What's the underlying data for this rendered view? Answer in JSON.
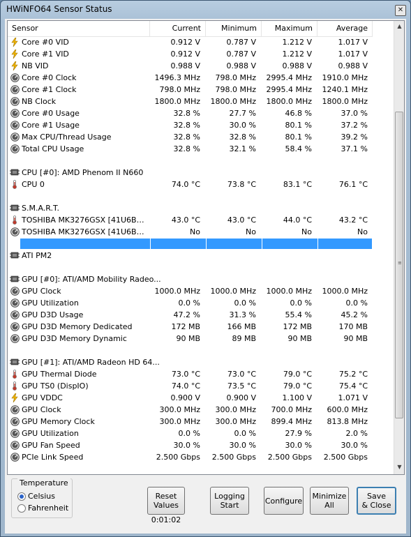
{
  "window": {
    "title": "HWiNFO64 Sensor Status",
    "close_glyph": "✕"
  },
  "columns": {
    "sensor": "Sensor",
    "current": "Current",
    "minimum": "Minimum",
    "maximum": "Maximum",
    "average": "Average"
  },
  "rows": [
    {
      "type": "data",
      "icon": "bolt",
      "name": "Core #0 VID",
      "cur": "0.912 V",
      "min": "0.787 V",
      "max": "1.212 V",
      "avg": "1.017 V"
    },
    {
      "type": "data",
      "icon": "bolt",
      "name": "Core #1 VID",
      "cur": "0.912 V",
      "min": "0.787 V",
      "max": "1.212 V",
      "avg": "1.017 V"
    },
    {
      "type": "data",
      "icon": "bolt",
      "name": "NB VID",
      "cur": "0.988 V",
      "min": "0.988 V",
      "max": "0.988 V",
      "avg": "0.988 V"
    },
    {
      "type": "data",
      "icon": "gauge",
      "name": "Core #0 Clock",
      "cur": "1496.3 MHz",
      "min": "798.0 MHz",
      "max": "2995.4 MHz",
      "avg": "1910.0 MHz"
    },
    {
      "type": "data",
      "icon": "gauge",
      "name": "Core #1 Clock",
      "cur": "798.0 MHz",
      "min": "798.0 MHz",
      "max": "2995.4 MHz",
      "avg": "1240.1 MHz"
    },
    {
      "type": "data",
      "icon": "gauge",
      "name": "NB Clock",
      "cur": "1800.0 MHz",
      "min": "1800.0 MHz",
      "max": "1800.0 MHz",
      "avg": "1800.0 MHz"
    },
    {
      "type": "data",
      "icon": "gauge",
      "name": "Core #0 Usage",
      "cur": "32.8 %",
      "min": "27.7 %",
      "max": "46.8 %",
      "avg": "37.0 %"
    },
    {
      "type": "data",
      "icon": "gauge",
      "name": "Core #1 Usage",
      "cur": "32.8 %",
      "min": "30.0 %",
      "max": "80.1 %",
      "avg": "37.2 %"
    },
    {
      "type": "data",
      "icon": "gauge",
      "name": "Max CPU/Thread Usage",
      "cur": "32.8 %",
      "min": "32.8 %",
      "max": "80.1 %",
      "avg": "39.2 %"
    },
    {
      "type": "data",
      "icon": "gauge",
      "name": "Total CPU Usage",
      "cur": "32.8 %",
      "min": "32.1 %",
      "max": "58.4 %",
      "avg": "37.1 %"
    },
    {
      "type": "blank"
    },
    {
      "type": "group",
      "icon": "chip",
      "name": "CPU [#0]: AMD Phenom II N660"
    },
    {
      "type": "data",
      "icon": "thermo",
      "name": "CPU 0",
      "cur": "74.0 °C",
      "min": "73.8 °C",
      "max": "83.1 °C",
      "avg": "76.1 °C"
    },
    {
      "type": "blank"
    },
    {
      "type": "group",
      "icon": "chip",
      "name": "S.M.A.R.T."
    },
    {
      "type": "data",
      "icon": "thermo",
      "name": "TOSHIBA MK3276GSX [41U6B01SB...",
      "cur": "43.0 °C",
      "min": "43.0 °C",
      "max": "44.0 °C",
      "avg": "43.2 °C"
    },
    {
      "type": "data",
      "icon": "gauge",
      "name": "TOSHIBA MK3276GSX [41U6B01SB...",
      "cur": "No",
      "min": "No",
      "max": "No",
      "avg": "No"
    },
    {
      "type": "selected"
    },
    {
      "type": "group",
      "icon": "chip",
      "name": "ATI PM2"
    },
    {
      "type": "blank"
    },
    {
      "type": "group",
      "icon": "chip",
      "name": "GPU [#0]: ATI/AMD Mobility Radeo..."
    },
    {
      "type": "data",
      "icon": "gauge",
      "name": "GPU Clock",
      "cur": "1000.0 MHz",
      "min": "1000.0 MHz",
      "max": "1000.0 MHz",
      "avg": "1000.0 MHz"
    },
    {
      "type": "data",
      "icon": "gauge",
      "name": "GPU Utilization",
      "cur": "0.0 %",
      "min": "0.0 %",
      "max": "0.0 %",
      "avg": "0.0 %"
    },
    {
      "type": "data",
      "icon": "gauge",
      "name": "GPU D3D Usage",
      "cur": "47.2 %",
      "min": "31.3 %",
      "max": "55.4 %",
      "avg": "45.2 %"
    },
    {
      "type": "data",
      "icon": "gauge",
      "name": "GPU D3D Memory Dedicated",
      "cur": "172 MB",
      "min": "166 MB",
      "max": "172 MB",
      "avg": "170 MB"
    },
    {
      "type": "data",
      "icon": "gauge",
      "name": "GPU D3D Memory Dynamic",
      "cur": "90 MB",
      "min": "89 MB",
      "max": "90 MB",
      "avg": "90 MB"
    },
    {
      "type": "blank"
    },
    {
      "type": "group",
      "icon": "chip",
      "name": "GPU [#1]: ATI/AMD Radeon HD 64..."
    },
    {
      "type": "data",
      "icon": "thermo",
      "name": "GPU Thermal Diode",
      "cur": "73.0 °C",
      "min": "73.0 °C",
      "max": "79.0 °C",
      "avg": "75.2 °C"
    },
    {
      "type": "data",
      "icon": "thermo",
      "name": "GPU TS0 (DispIO)",
      "cur": "74.0 °C",
      "min": "73.5 °C",
      "max": "79.0 °C",
      "avg": "75.4 °C"
    },
    {
      "type": "data",
      "icon": "bolt",
      "name": "GPU VDDC",
      "cur": "0.900 V",
      "min": "0.900 V",
      "max": "1.100 V",
      "avg": "1.071 V"
    },
    {
      "type": "data",
      "icon": "gauge",
      "name": "GPU Clock",
      "cur": "300.0 MHz",
      "min": "300.0 MHz",
      "max": "700.0 MHz",
      "avg": "600.0 MHz"
    },
    {
      "type": "data",
      "icon": "gauge",
      "name": "GPU Memory Clock",
      "cur": "300.0 MHz",
      "min": "300.0 MHz",
      "max": "899.4 MHz",
      "avg": "813.8 MHz"
    },
    {
      "type": "data",
      "icon": "gauge",
      "name": "GPU Utilization",
      "cur": "0.0 %",
      "min": "0.0 %",
      "max": "27.9 %",
      "avg": "2.0 %"
    },
    {
      "type": "data",
      "icon": "gauge",
      "name": "GPU Fan Speed",
      "cur": "30.0 %",
      "min": "30.0 %",
      "max": "30.0 %",
      "avg": "30.0 %"
    },
    {
      "type": "data",
      "icon": "gauge",
      "name": "PCIe Link Speed",
      "cur": "2.500 Gbps",
      "min": "2.500 Gbps",
      "max": "2.500 Gbps",
      "avg": "2.500 Gbps"
    }
  ],
  "temperature": {
    "legend": "Temperature",
    "celsius": "Celsius",
    "fahrenheit": "Fahrenheit",
    "selected": "Celsius"
  },
  "buttons": {
    "reset": [
      "Reset",
      "Values"
    ],
    "logging": [
      "Logging",
      "Start"
    ],
    "configure": "Configure",
    "minimize": [
      "Minimize",
      "All"
    ],
    "save": [
      "Save",
      "& Close"
    ]
  },
  "timer": "0:01:02",
  "colors": {
    "selection": "#3399ff",
    "bolt": "#f2b600",
    "thermo": "#c0392b",
    "gauge": "#555555"
  }
}
